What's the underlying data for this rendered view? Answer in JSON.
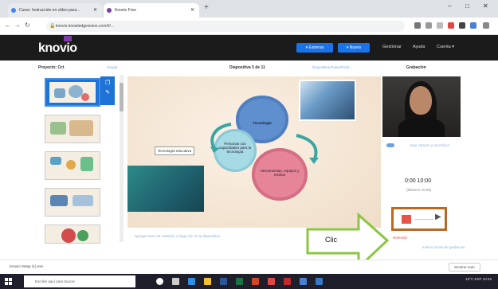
{
  "browser": {
    "tabs": [
      {
        "title": "Curso: Instrucción en vídeo para...",
        "fav_color": "#4285f4"
      },
      {
        "title": "Knovio Free",
        "fav_color": "#7a3fa0"
      }
    ],
    "url": "knovio.knowledgevision.com/#/...",
    "new_tab_label": "+",
    "win_controls": [
      "–",
      "□",
      "✕"
    ]
  },
  "header": {
    "logo": "knovio",
    "buttons": [
      "▾ Estrenar",
      "▾ Nuevo"
    ],
    "links": [
      "Gestionar",
      "Ayuda",
      "Cuenta ▾"
    ]
  },
  "project": {
    "title": "Proyecto: Cct",
    "upload_link": "Cargar",
    "slide_counter": "Diapositiva 5 de 11",
    "slide_link": "Diapositiva PowerPoint...",
    "recording_title": "Grabación"
  },
  "slide": {
    "gear_tech": "Tecnología",
    "gear_connect": "Personas con capacidades para la tecnología",
    "gear_tools": "Herramientas, equipos y medios",
    "callout": "Tecnología educativa",
    "caption": "Agregar texto de subtítulo o haga clic en la diapositiva"
  },
  "recording": {
    "cam_note": "Usar cámara y micrófono",
    "time": "0:00  10:00",
    "time_sub": "(Máximo 10:00)",
    "status": "Detenido",
    "help": "Instrucciones de grabación",
    "clic": "Clic"
  },
  "bottom": {
    "left_label": "Knovio Setup (1).exe",
    "right_label": "Mostrar todo"
  },
  "taskbar": {
    "search_placeholder": "Escribe aquí para buscar",
    "tray_text": "15°C  ESP  10:45"
  }
}
